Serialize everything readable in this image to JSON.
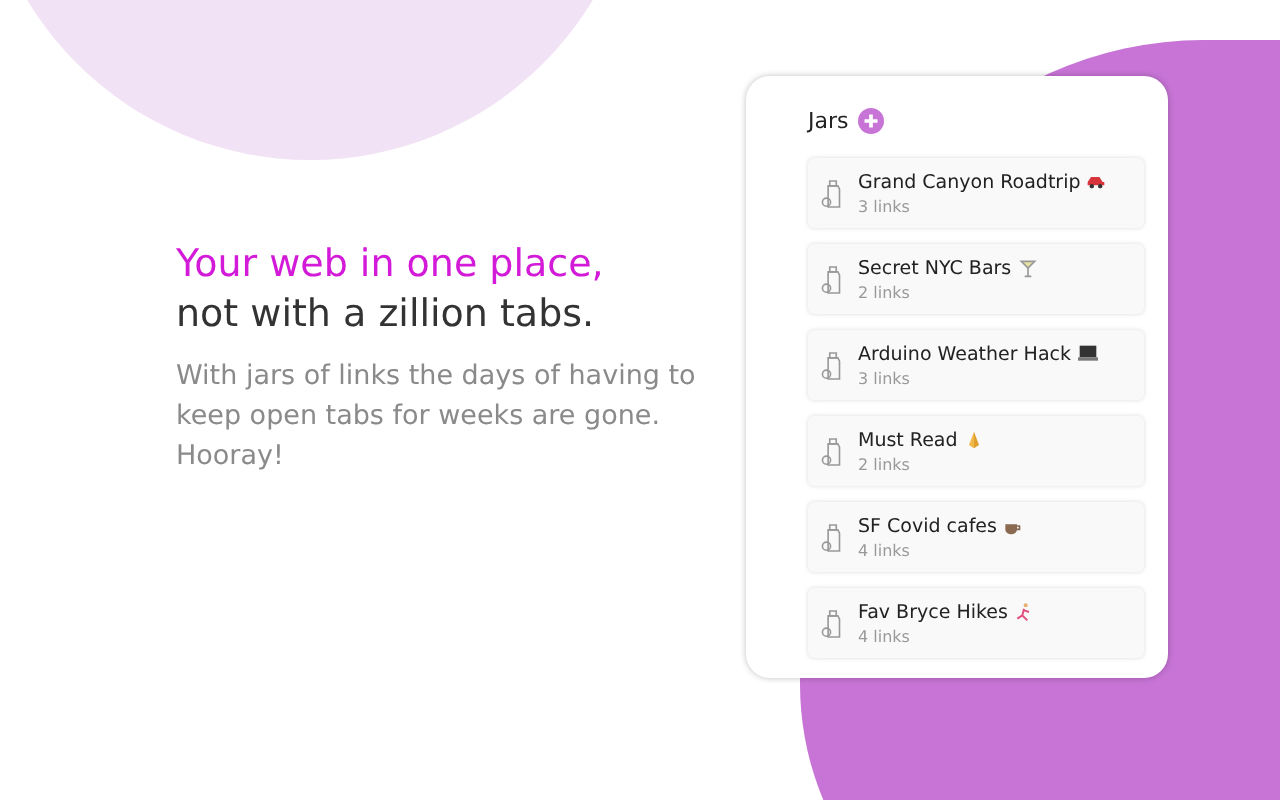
{
  "headline": {
    "accent": "Your web in one place,",
    "rest": "not with a zillion tabs."
  },
  "description": "With jars of links the days of having to keep open tabs for weeks are gone. Hooray!",
  "panel": {
    "title": "Jars",
    "jars": [
      {
        "name": "Grand Canyon Roadtrip",
        "count": "3 links"
      },
      {
        "name": "Secret NYC Bars",
        "count": "2 links"
      },
      {
        "name": "Arduino Weather Hack",
        "count": "3 links"
      },
      {
        "name": "Must Read",
        "count": "2 links"
      },
      {
        "name": "SF Covid cafes",
        "count": "4 links"
      },
      {
        "name": "Fav Bryce Hikes",
        "count": "4 links"
      }
    ]
  }
}
